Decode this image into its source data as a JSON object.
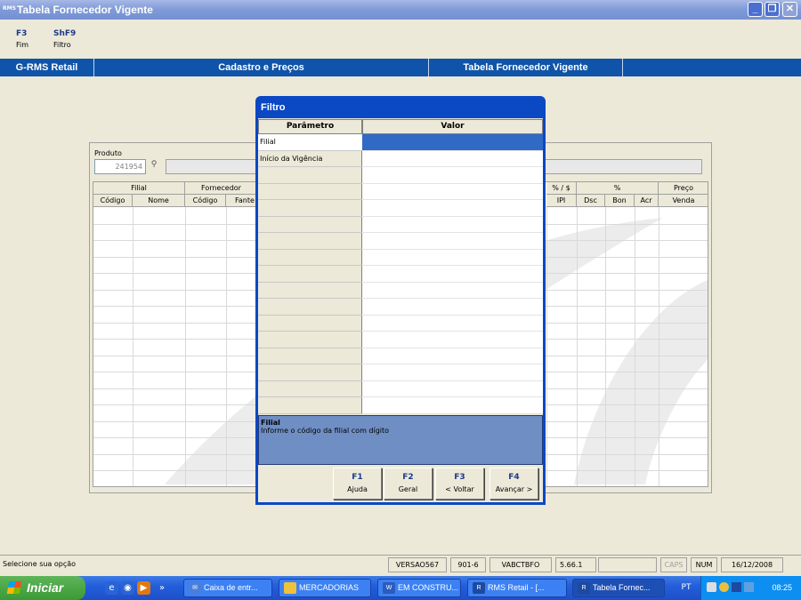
{
  "window": {
    "app_icon": "RMS",
    "title": "Tabela Fornecedor Vigente"
  },
  "function_keys": [
    {
      "key": "F3",
      "label": "Fim"
    },
    {
      "key": "ShF9",
      "label": "Filtro"
    }
  ],
  "ribbon": {
    "system": "G-RMS Retail",
    "module": "Cadastro e Preços",
    "screen": "Tabela Fornecedor Vigente"
  },
  "product": {
    "label": "Produto",
    "code": "241954"
  },
  "grid": {
    "group_headers": [
      "Filial",
      "Fornecedor",
      "% / $",
      "%",
      "Preço"
    ],
    "headers": [
      "Código",
      "Nome",
      "Código",
      "Fante",
      "IPI",
      "Dsc",
      "Bon",
      "Acr",
      "Venda"
    ]
  },
  "dialog": {
    "title": "Filtro",
    "col_param": "Parâmetro",
    "col_value": "Valor",
    "params": [
      "Filial",
      "Início da Vigência"
    ],
    "help_title": "Filial",
    "help_text": "Informe o código da filial com dígito",
    "buttons": [
      {
        "key": "F1",
        "label": "Ajuda"
      },
      {
        "key": "F2",
        "label": "Geral"
      },
      {
        "key": "F3",
        "label": "< Voltar"
      },
      {
        "key": "F4",
        "label": "Avançar >"
      }
    ]
  },
  "status": {
    "message": "Selecione sua opção",
    "version": "VERSAO567",
    "code": "901-6",
    "program": "VABCTBFO",
    "build": "5.66.1",
    "caps": "CAPS",
    "num": "NUM",
    "date": "16/12/2008"
  },
  "taskbar": {
    "start": "Iniciar",
    "tasks": [
      "Caixa de entr...",
      "MERCADORIAS",
      "EM CONSTRU...",
      "RMS Retail - [...",
      "Tabela Fornec..."
    ],
    "lang": "PT",
    "time": "08:25"
  }
}
